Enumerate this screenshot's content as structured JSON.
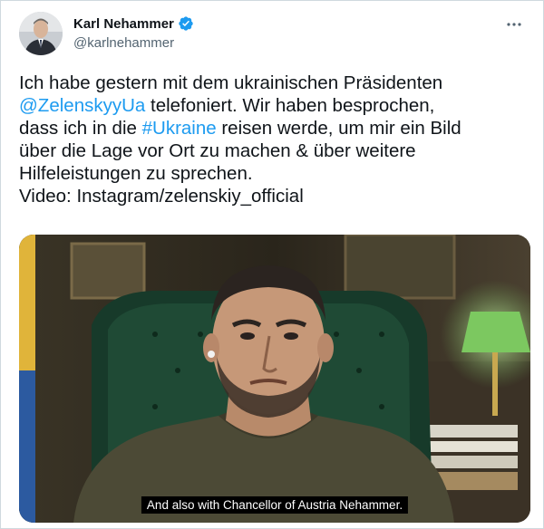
{
  "author": {
    "display_name": "Karl Nehammer",
    "handle": "@karlnehammer",
    "verified_icon": "verified-badge-icon",
    "avatar_icon": "profile-photo"
  },
  "menu": {
    "more_icon": "more-horizontal-icon"
  },
  "tweet": {
    "part1": "Ich habe gestern mit dem ukrainischen Präsidenten\n",
    "mention": "@ZelenskyyUa",
    "part2": " telefoniert. Wir haben besprochen,\ndass ich in die ",
    "hashtag": "#Ukraine",
    "part3": " reisen werde, um mir ein Bild\nüber die Lage vor Ort zu machen & über weitere\nHilfeleistungen zu sprechen.\nVideo: Instagram/zelenskiy_official"
  },
  "media": {
    "subtitle": "And also with Chancellor of Austria Nehammer."
  },
  "colors": {
    "link": "#1d9bf0",
    "text": "#0f1419",
    "secondary": "#536471",
    "border": "#cfd9de"
  }
}
